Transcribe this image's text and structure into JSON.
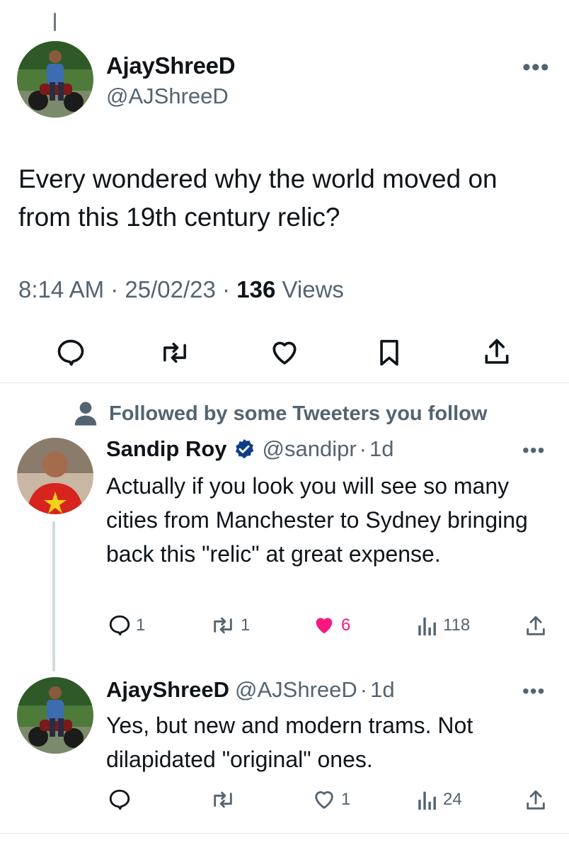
{
  "main_tweet": {
    "display_name": "AjayShreeD",
    "handle": "@AJShreeD",
    "more": "•••",
    "text": "Every wondered why the world moved on from this 19th century relic?",
    "time": "8:14 AM",
    "sep1": "·",
    "date": "25/02/23",
    "sep2": "·",
    "views_count": "136",
    "views_label": "Views"
  },
  "social_context": "Followed by some Tweeters you follow",
  "reply1": {
    "display_name": "Sandip Roy",
    "handle": "@sandipr",
    "sep": "·",
    "age": "1d",
    "more": "•••",
    "text": "Actually if you look you will see so many cities from Manchester to Sydney bringing back this \"relic\" at great expense.",
    "replies": "1",
    "retweets": "1",
    "likes": "6",
    "views": "118",
    "liked": true
  },
  "reply2": {
    "display_name": "AjayShreeD",
    "handle": "@AJShreeD",
    "sep": "·",
    "age": "1d",
    "more": "•••",
    "text": "Yes, but new and modern trams. Not dilapidated \"original\" ones.",
    "likes": "1",
    "views": "24"
  },
  "colors": {
    "text": "#0f1419",
    "muted": "#536471",
    "like_active": "#f91880",
    "verified": "#1d9bf0"
  }
}
